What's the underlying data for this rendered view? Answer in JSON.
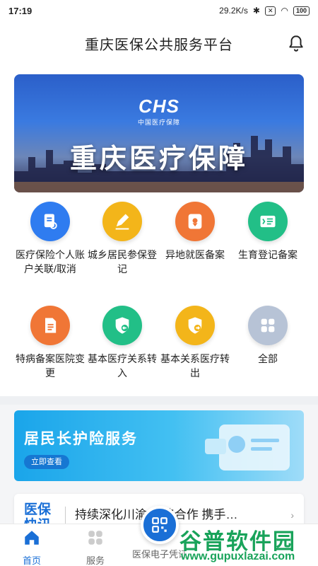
{
  "status": {
    "time": "17:19",
    "speed": "29.2K/s",
    "battery": "100"
  },
  "header": {
    "title": "重庆医保公共服务平台",
    "bell_icon": "bell-icon"
  },
  "banner": {
    "logo_text": "CHS",
    "logo_sub": "中国医疗保障",
    "title": "重庆医疗保障"
  },
  "services": [
    {
      "label": "医疗保险个人账户关联/取消",
      "icon": "document-link-icon",
      "color": "#2f7cf0"
    },
    {
      "label": "城乡居民参保登记",
      "icon": "edit-pencil-icon",
      "color": "#f3b51a"
    },
    {
      "label": "异地就医备案",
      "icon": "location-card-icon",
      "color": "#f07636"
    },
    {
      "label": "生育登记备案",
      "icon": "id-card-icon",
      "color": "#22bf87"
    },
    {
      "label": "特病备案医院变更",
      "icon": "clipboard-icon",
      "color": "#f07636"
    },
    {
      "label": "基本医疗关系转入",
      "icon": "shield-transfer-in-icon",
      "color": "#22bf87"
    },
    {
      "label": "基本关系医疗转出",
      "icon": "shield-transfer-out-icon",
      "color": "#f3b51a"
    },
    {
      "label": "全部",
      "icon": "grid-all-icon",
      "color": "#b7c3d6"
    }
  ],
  "promo": {
    "title": "居民长护险服务",
    "button": "立即查看"
  },
  "news": {
    "tag": "医保\n快讯",
    "text": "持续深化川渝   战略合作 携手…"
  },
  "tabs": {
    "home": "首页",
    "service": "服务",
    "ecard": "医保电子凭证"
  },
  "watermark": {
    "main": "谷普软件园",
    "url": "www.gupuxlazai.com"
  }
}
